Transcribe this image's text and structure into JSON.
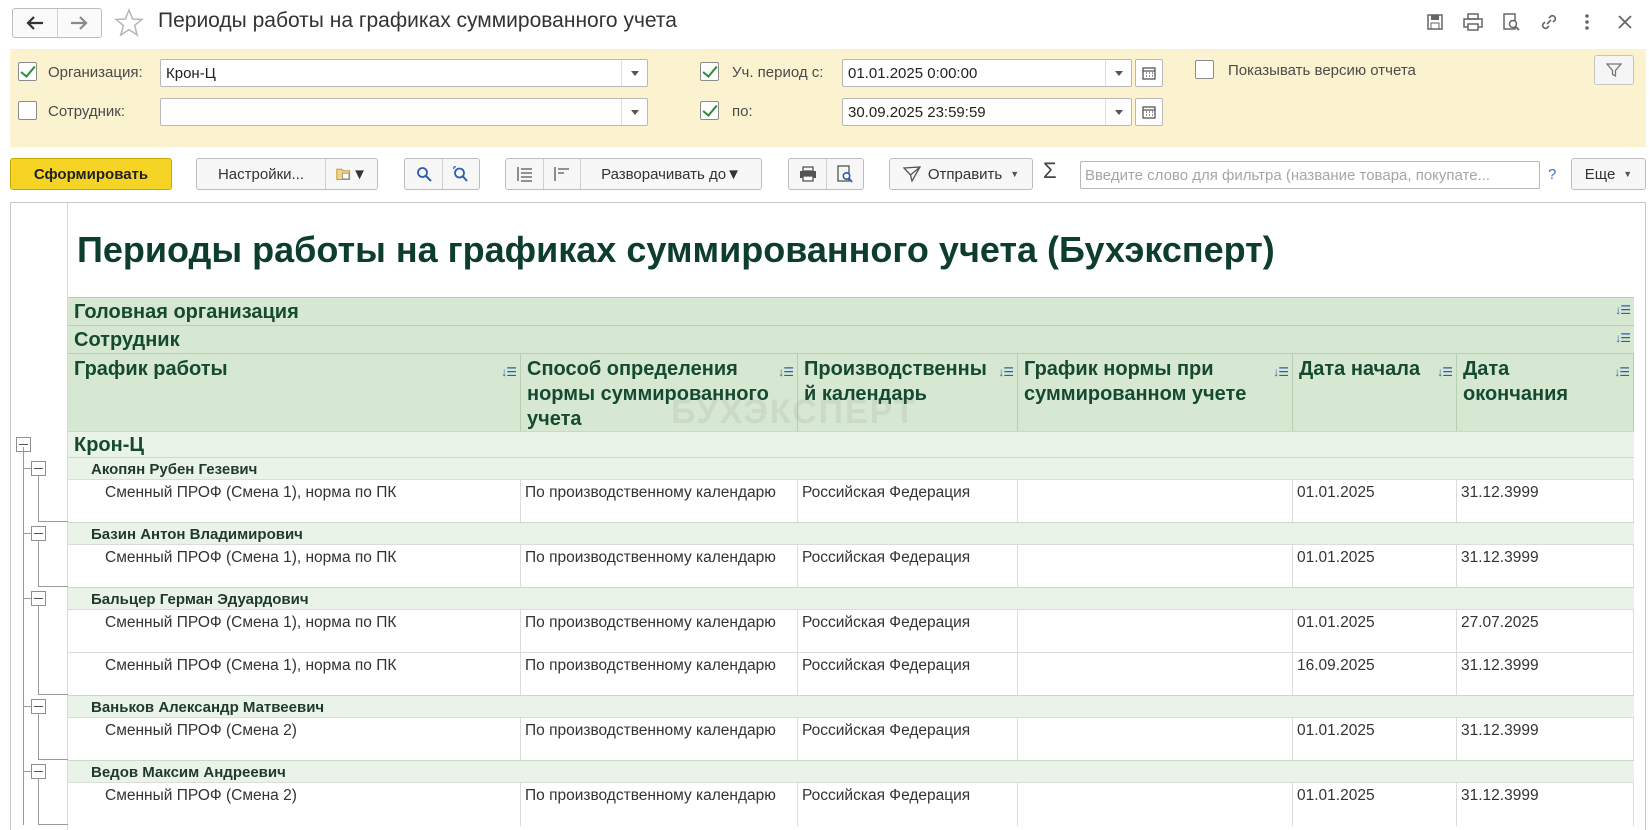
{
  "window": {
    "title": "Периоды работы на графиках суммированного учета"
  },
  "params": {
    "org_label": "Организация:",
    "org_value": "Крон-Ц",
    "employee_label": "Сотрудник:",
    "employee_value": "",
    "period_from_label": "Уч. период с:",
    "period_from_value": "01.01.2025  0:00:00",
    "period_to_label": "по:",
    "period_to_value": "30.09.2025 23:59:59",
    "show_version_label": "Показывать версию отчета",
    "org_checked": true,
    "employee_checked": false,
    "period_from_checked": true,
    "period_to_checked": true,
    "show_version_checked": false
  },
  "toolbar": {
    "generate_label": "Сформировать",
    "settings_label": "Настройки...",
    "expand_label": "Разворачивать до",
    "send_label": "Отправить",
    "search_placeholder": "Введите слово для фильтра (название товара, покупате...",
    "help_label": "?",
    "more_label": "Еще"
  },
  "report": {
    "title": "Периоды работы на графиках суммированного учета (Бухэксперт)",
    "watermark": "БУХЭКСПЕРТ",
    "group_headers": [
      "Головная организация",
      "Сотрудник"
    ],
    "columns": [
      "График работы",
      "Способ определения нормы суммированного учета",
      "Производственный календарь",
      "График нормы при суммированном учете",
      "Дата начала",
      "Дата окончания"
    ],
    "organization": "Крон-Ц",
    "employees": [
      {
        "name": "Акопян Рубен Гезевич",
        "rows": [
          {
            "schedule": "Сменный ПРОФ (Смена 1), норма по ПК",
            "method": "По производственному календарю",
            "calendar": "Российская Федерация",
            "norm_schedule": "",
            "start": "01.01.2025",
            "end": "31.12.3999"
          }
        ]
      },
      {
        "name": "Базин Антон Владимирович",
        "rows": [
          {
            "schedule": "Сменный ПРОФ (Смена 1), норма по ПК",
            "method": "По производственному календарю",
            "calendar": "Российская Федерация",
            "norm_schedule": "",
            "start": "01.01.2025",
            "end": "31.12.3999"
          }
        ]
      },
      {
        "name": "Бальцер Герман Эдуардович",
        "rows": [
          {
            "schedule": "Сменный ПРОФ (Смена 1), норма по ПК",
            "method": "По производственному календарю",
            "calendar": "Российская Федерация",
            "norm_schedule": "",
            "start": "01.01.2025",
            "end": "27.07.2025"
          },
          {
            "schedule": "Сменный ПРОФ (Смена 1), норма по ПК",
            "method": "По производственному календарю",
            "calendar": "Российская Федерация",
            "norm_schedule": "",
            "start": "16.09.2025",
            "end": "31.12.3999"
          }
        ]
      },
      {
        "name": "Ваньков Александр Матвеевич",
        "rows": [
          {
            "schedule": "Сменный ПРОФ (Смена 2)",
            "method": "По производственному календарю",
            "calendar": "Российская Федерация",
            "norm_schedule": "",
            "start": "01.01.2025",
            "end": "31.12.3999"
          }
        ]
      },
      {
        "name": "Ведов Максим Андреевич",
        "rows": [
          {
            "schedule": "Сменный ПРОФ (Смена 2)",
            "method": "По производственному календарю",
            "calendar": "Российская Федерация",
            "norm_schedule": "",
            "start": "01.01.2025",
            "end": "31.12.3999"
          }
        ]
      }
    ]
  },
  "colors": {
    "accent_button": "#f6d426",
    "params_background": "#fbf3cf",
    "header_green": "#d6e8d1",
    "group_green": "#eaf3e7",
    "title_text": "#0d3d2c"
  }
}
